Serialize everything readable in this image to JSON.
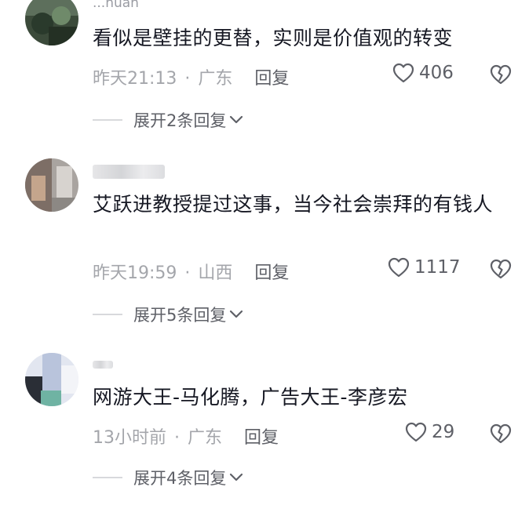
{
  "comments": [
    {
      "username": "...nuan",
      "content": "看似是壁挂的更替，实则是价值观的转变",
      "time": "昨天21:13",
      "location": "广东",
      "reply_label": "回复",
      "likes": "406",
      "expand_label": "展开2条回复"
    },
    {
      "username": "",
      "content": "艾跃进教授提过这事，当今社会崇拜的有钱人",
      "time": "昨天19:59",
      "location": "山西",
      "reply_label": "回复",
      "likes": "1117",
      "expand_label": "展开5条回复"
    },
    {
      "username": "",
      "content": "网游大王-马化腾，广告大王-李彦宏",
      "time": "13小时前",
      "location": "广东",
      "reply_label": "回复",
      "likes": "29",
      "expand_label": "展开4条回复"
    }
  ],
  "separator": "·",
  "icons": {
    "like": "heart-outline-icon",
    "dislike": "broken-heart-icon",
    "expand": "chevron-down-icon"
  },
  "colors": {
    "text_primary": "#161823",
    "text_secondary": "#a4a6ab",
    "text_action": "#5e6067"
  }
}
